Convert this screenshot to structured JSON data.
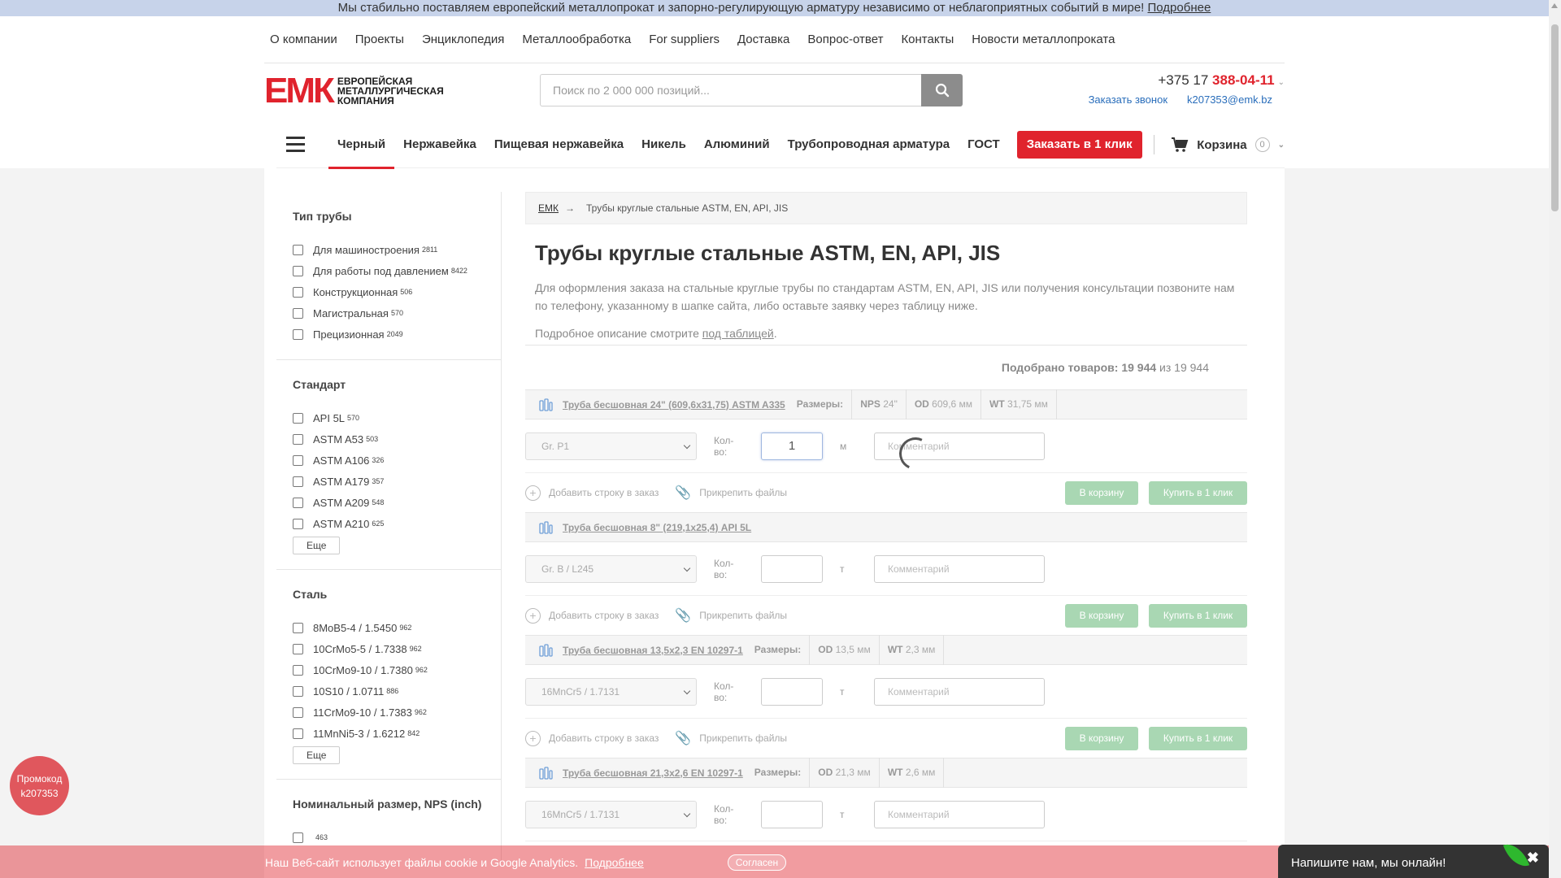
{
  "topbar": {
    "text": "Мы стабильно поставляем европейский металлопрокат и запорно-регулирующую арматуру независимо от неблагоприятных событий в мире!",
    "link": "Подробнее"
  },
  "topnav": [
    "О компании",
    "Проекты",
    "Энциклопедия",
    "Металлообработка",
    "For suppliers",
    "Доставка",
    "Вопрос-ответ",
    "Контакты",
    "Новости металлопроката"
  ],
  "logo": {
    "mark": "ЕМК",
    "line1": "Европейская",
    "line2": "металлургическая",
    "line3": "компания"
  },
  "search": {
    "placeholder": "Поиск по 2 000 000 позиций..."
  },
  "phone": {
    "prefix": "+375 17",
    "number": "388-04-11",
    "callback": "Заказать звонок",
    "email": "k207353@emk.bz"
  },
  "catnav": {
    "items": [
      "Черный",
      "Нержавейка",
      "Пищевая нержавейка",
      "Никель",
      "Алюминий",
      "Трубопроводная арматура",
      "ГОСТ"
    ],
    "oneclick": "Заказать в 1 клик",
    "cart": "Корзина",
    "cart_count": "0"
  },
  "filters": [
    {
      "title": "Тип трубы",
      "items": [
        [
          "Для машиностроения",
          "2811"
        ],
        [
          "Для работы под давлением",
          "8422"
        ],
        [
          "Конструкционная",
          "506"
        ],
        [
          "Магистральная",
          "570"
        ],
        [
          "Прецизионная",
          "2049"
        ]
      ],
      "more": ""
    },
    {
      "title": "Стандарт",
      "items": [
        [
          "API 5L",
          "570"
        ],
        [
          "ASTM A53",
          "503"
        ],
        [
          "ASTM A106",
          "326"
        ],
        [
          "ASTM A179",
          "357"
        ],
        [
          "ASTM A209",
          "548"
        ],
        [
          "ASTM A210",
          "625"
        ]
      ],
      "more": "Еще"
    },
    {
      "title": "Сталь",
      "items": [
        [
          "8MoB5-4 / 1.5450",
          "962"
        ],
        [
          "10CrMo5-5 / 1.7338",
          "962"
        ],
        [
          "10CrMo9-10 / 1.7380",
          "962"
        ],
        [
          "10S10 / 1.0711",
          "886"
        ],
        [
          "11CrMo9-10 / 1.7383",
          "962"
        ],
        [
          "11MnNi5-3 / 1.6212",
          "842"
        ]
      ],
      "more": "Еще"
    },
    {
      "title": "Номинальный размер, NPS (inch)",
      "items": [
        [
          "",
          "463"
        ]
      ],
      "more": ""
    }
  ],
  "breadcrumbs": {
    "home": "ЕМК",
    "arrow": "→",
    "current": "Трубы круглые стальные ASTM, EN, API, JIS"
  },
  "main": {
    "title": "Трубы круглые стальные ASTM, EN, API, JIS",
    "desc": "Для оформления заказа на стальные круглые трубы по стандартам ASTM, EN, API, JIS или получения консультации позвоните нам по телефону, указанному в шапке сайта, либо оставьте заявку через таблицу ниже.",
    "desc2_prefix": "Подробное описание смотрите ",
    "desc2_link": "под таблицей",
    "desc2_suffix": ".",
    "found_label": "Подобрано товаров:",
    "found_count": "19 944",
    "found_of": "из 19 944"
  },
  "labels": {
    "sizes": "Размеры:",
    "qty": "Кол-во:",
    "comment": "Комментарий",
    "add_row": "Добавить строку в заказ",
    "attach": "Прикрепить файлы",
    "to_cart": "В корзину",
    "buy_one": "Купить в 1 клик"
  },
  "products": [
    {
      "title": "Труба бесшовная 24\" (609,6x31,75) ASTM A335",
      "dims": [
        [
          "NPS",
          "24\""
        ],
        [
          "OD",
          "609,6 мм"
        ],
        [
          "WT",
          "31,75 мм"
        ]
      ],
      "grade": "Gr. P1",
      "qty": "1",
      "unit": "м"
    },
    {
      "title": "Труба бесшовная 8\" (219,1x25,4) API 5L",
      "dims": [],
      "grade": "Gr. B / L245",
      "qty": "",
      "unit": "т"
    },
    {
      "title": "Труба бесшовная 13,5x2,3 EN 10297-1",
      "dims": [
        [
          "OD",
          "13,5 мм"
        ],
        [
          "WT",
          "2,3 мм"
        ]
      ],
      "grade": "16MnCr5 / 1.7131",
      "qty": "",
      "unit": "т"
    },
    {
      "title": "Труба бесшовная 21,3x2,6 EN 10297-1",
      "dims": [
        [
          "OD",
          "21,3 мм"
        ],
        [
          "WT",
          "2,6 мм"
        ]
      ],
      "grade": "16MnCr5 / 1.7131",
      "qty": "",
      "unit": "т"
    }
  ],
  "promo": {
    "line1": "Промокод",
    "line2": "k207353"
  },
  "cookie": {
    "text": "Наш Веб-сайт использует файлы cookie и Google Analytics.",
    "link": "Подробнее",
    "agree": "Согласен"
  },
  "chat": {
    "text": "Напишите нам, мы онлайн!",
    "close": "✖"
  },
  "colors": {
    "brand": "#e0232d",
    "link": "#2a6ebb",
    "green_button": "#a9d7b3",
    "topbar": "#c7d3ea"
  }
}
